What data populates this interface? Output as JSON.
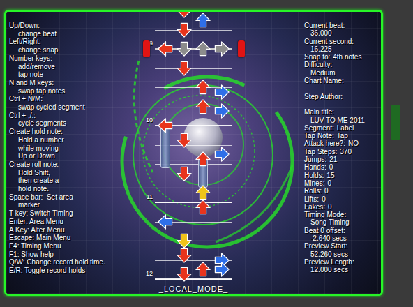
{
  "help": [
    {
      "text": "Up/Down:",
      "indent": false
    },
    {
      "text": "change beat",
      "indent": true
    },
    {
      "text": "Left/Right:",
      "indent": false
    },
    {
      "text": "change snap",
      "indent": true
    },
    {
      "text": "Number keys:",
      "indent": false
    },
    {
      "text": "add/remove",
      "indent": true
    },
    {
      "text": "tap note",
      "indent": true
    },
    {
      "text": "N and M keys:",
      "indent": false
    },
    {
      "text": "swap tap notes",
      "indent": true
    },
    {
      "text": "Ctrl + N/M:",
      "indent": false
    },
    {
      "text": "swap cycled segment",
      "indent": true
    },
    {
      "text": "Ctrl + ,/.:",
      "indent": false
    },
    {
      "text": "cycle segments",
      "indent": true
    },
    {
      "text": "Create hold note:",
      "indent": false
    },
    {
      "text": "Hold a number",
      "indent": true
    },
    {
      "text": "while moving",
      "indent": true
    },
    {
      "text": "Up or Down",
      "indent": true
    },
    {
      "text": "Create roll note:",
      "indent": false
    },
    {
      "text": "Hold Shift,",
      "indent": true
    },
    {
      "text": "then create a",
      "indent": true
    },
    {
      "text": "hold note.",
      "indent": true
    },
    {
      "text": "Space bar:  Set area",
      "indent": false
    },
    {
      "text": "marker",
      "indent": true
    },
    {
      "text": "T key: Switch Timing",
      "indent": false
    },
    {
      "text": "Enter: Area Menu",
      "indent": false
    },
    {
      "text": "A Key: Alter Menu",
      "indent": false
    },
    {
      "text": "Escape: Main Menu",
      "indent": false
    },
    {
      "text": "F4: Timing Menu",
      "indent": false
    },
    {
      "text": "F1: Show help",
      "indent": false
    },
    {
      "text": "Q/W: Change record hold time.",
      "indent": false
    },
    {
      "text": "E/R: Toggle record holds",
      "indent": false
    }
  ],
  "info": [
    {
      "label": "Current beat:",
      "value": "36.000",
      "kind": "stacked"
    },
    {
      "label": "Current second:",
      "value": "16.225",
      "kind": "stacked"
    },
    {
      "label": "Snap to:",
      "value": "4th notes",
      "kind": "inline"
    },
    {
      "label": "Difficulty:",
      "value": "Medium",
      "kind": "stacked"
    },
    {
      "label": "Chart Name:",
      "value": "",
      "kind": "stacked"
    },
    {
      "label": "Step Author:",
      "value": "",
      "kind": "stacked"
    },
    {
      "label": "Main title:",
      "value": "LUV TO ME 2011",
      "kind": "stacked"
    },
    {
      "label": "Segment:",
      "value": "Label",
      "kind": "inline"
    },
    {
      "label": "Tap Note:",
      "value": "Tap",
      "kind": "inline"
    },
    {
      "label": "Attack here?:",
      "value": "NO",
      "kind": "inline"
    },
    {
      "label": "Tap Steps:",
      "value": "370",
      "kind": "inline"
    },
    {
      "label": "Jumps:",
      "value": "21",
      "kind": "inline"
    },
    {
      "label": "Hands:",
      "value": "0",
      "kind": "inline"
    },
    {
      "label": "Holds:",
      "value": "15",
      "kind": "inline"
    },
    {
      "label": "Mines:",
      "value": "0",
      "kind": "inline"
    },
    {
      "label": "Rolls:",
      "value": "0",
      "kind": "inline"
    },
    {
      "label": "Lifts:",
      "value": "0",
      "kind": "inline"
    },
    {
      "label": "Fakes:",
      "value": "0",
      "kind": "inline"
    },
    {
      "label": "Timing Mode:",
      "value": "Song Timing",
      "kind": "stacked"
    },
    {
      "label": "Beat 0 offset:",
      "value": "-2.640 secs",
      "kind": "stacked"
    },
    {
      "label": "Preview Start:",
      "value": "52.260 secs",
      "kind": "stacked"
    },
    {
      "label": "Preview Length:",
      "value": "12.000 secs",
      "kind": "stacked"
    }
  ],
  "field": {
    "receptor_beat": 36,
    "measures": [
      {
        "label": "9",
        "beat": 36
      },
      {
        "label": "10",
        "beat": 40
      },
      {
        "label": "11",
        "beat": 44
      },
      {
        "label": "12",
        "beat": 48
      }
    ],
    "notes": [
      {
        "beat": 34,
        "lane": "down",
        "color": "#e8341c"
      },
      {
        "beat": 34.5,
        "lane": "up",
        "color": "#2f6fe8"
      },
      {
        "beat": 35,
        "lane": "down",
        "color": "#e8341c"
      },
      {
        "beat": 36,
        "lane": "left",
        "color": "#e8341c"
      },
      {
        "beat": 37,
        "lane": "down",
        "color": "#e8341c"
      },
      {
        "beat": 38,
        "lane": "up",
        "color": "#e8341c"
      },
      {
        "beat": 38.25,
        "lane": "right",
        "color": "#2f6fe8"
      },
      {
        "beat": 39,
        "lane": "up",
        "color": "#e8341c"
      },
      {
        "beat": 39.25,
        "lane": "right",
        "color": "#2f6fe8"
      },
      {
        "beat": 40,
        "lane": "left",
        "color": "#e8341c",
        "hold_end": 42
      },
      {
        "beat": 40.75,
        "lane": "down",
        "color": "#e8341c"
      },
      {
        "beat": 41.5,
        "lane": "right",
        "color": "#2f6fe8"
      },
      {
        "beat": 41.75,
        "lane": "up",
        "color": "#e8341c",
        "hold_end": 43
      },
      {
        "beat": 42.5,
        "lane": "down",
        "color": "#e8341c"
      },
      {
        "beat": 43.5,
        "lane": "up",
        "color": "#f0c419"
      },
      {
        "beat": 44.25,
        "lane": "up",
        "color": "#e8341c"
      },
      {
        "beat": 45,
        "lane": "left",
        "color": "#2f6fe8"
      },
      {
        "beat": 46,
        "lane": "down",
        "color": "#f0c419"
      },
      {
        "beat": 46.75,
        "lane": "down",
        "color": "#e8341c"
      },
      {
        "beat": 47,
        "lane": "right",
        "color": "#2f6fe8"
      },
      {
        "beat": 47.5,
        "lane": "up",
        "color": "#e8341c"
      },
      {
        "beat": 47.5,
        "lane": "right",
        "color": "#2f6fe8"
      },
      {
        "beat": 47.75,
        "lane": "down",
        "color": "#e8341c"
      }
    ]
  },
  "mode_label": "_LOCAL_MODE_"
}
